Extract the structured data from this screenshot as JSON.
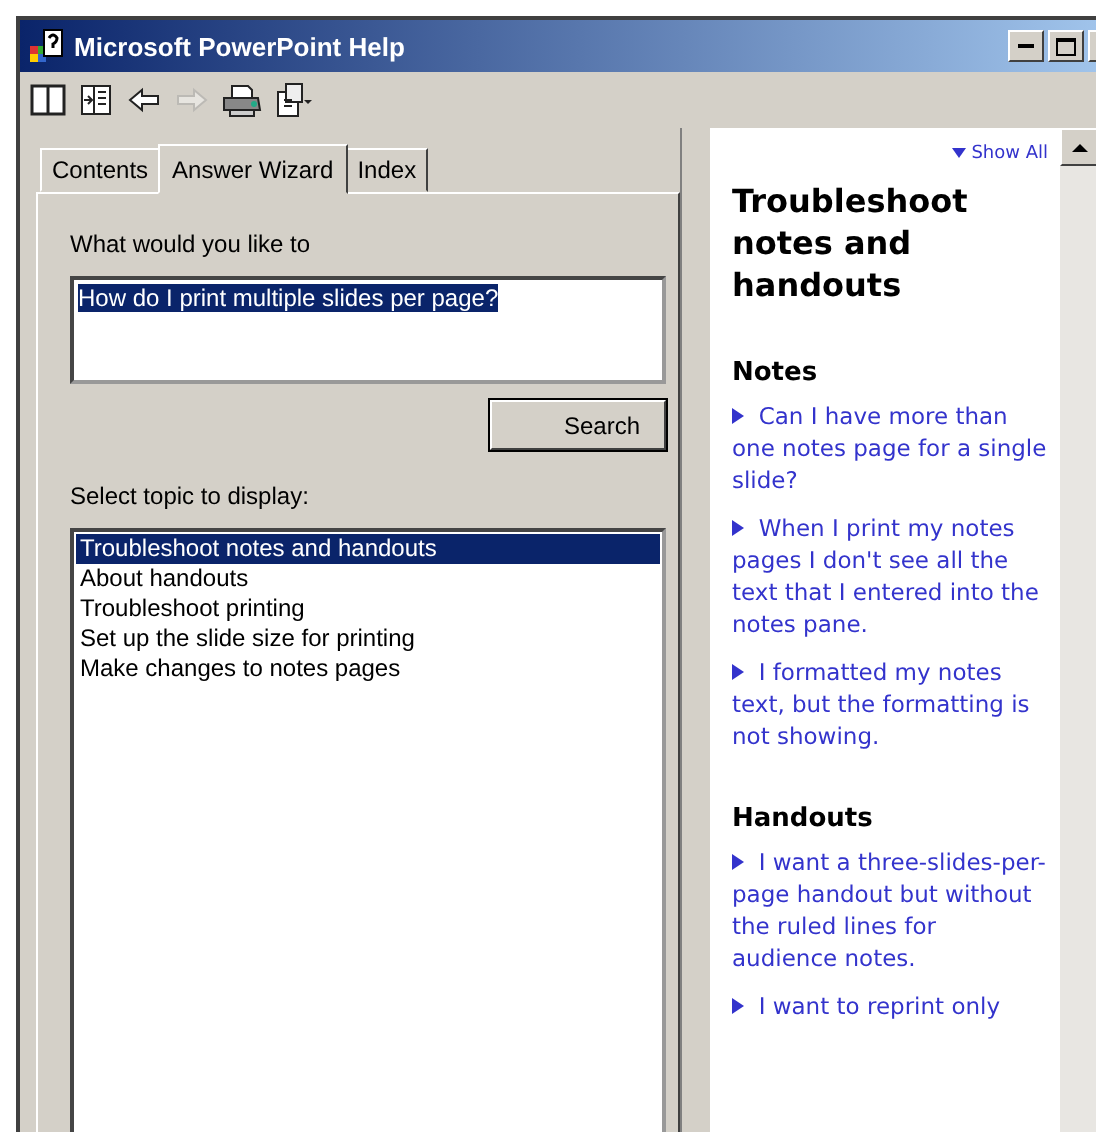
{
  "window": {
    "title": "Microsoft PowerPoint Help"
  },
  "toolbar": [
    {
      "kind": "split",
      "disabled": false
    },
    {
      "kind": "contents",
      "disabled": false
    },
    {
      "kind": "back",
      "disabled": false
    },
    {
      "kind": "forward",
      "disabled": true
    },
    {
      "kind": "print",
      "disabled": false
    },
    {
      "kind": "options",
      "disabled": false
    }
  ],
  "tabs": [
    {
      "label": "Contents",
      "selected": false
    },
    {
      "label": "Answer Wizard",
      "selected": true
    },
    {
      "label": "Index",
      "selected": false
    }
  ],
  "question": {
    "label": "What would you like to",
    "value": "How do I print multiple slides per page?"
  },
  "search_button": "Search",
  "topics": {
    "label": "Select topic to display:",
    "items": [
      {
        "label": "Troubleshoot notes and handouts",
        "selected": true
      },
      {
        "label": "About handouts",
        "selected": false
      },
      {
        "label": "Troubleshoot printing",
        "selected": false
      },
      {
        "label": "Set up the slide size for printing",
        "selected": false
      },
      {
        "label": "Make changes to notes pages",
        "selected": false
      }
    ]
  },
  "article": {
    "show_all": "Show All",
    "title": "Troubleshoot notes and handouts",
    "sections": [
      {
        "heading": "Notes",
        "links": [
          "Can I have more than one notes page for a single slide?",
          "When I print my notes pages I don't see all the text that I entered into the notes pane.",
          "I formatted my notes text, but the formatting is not showing."
        ]
      },
      {
        "heading": "Handouts",
        "links": [
          "I want a three-slides-per-page handout but without the ruled lines for audience notes.",
          "I want to reprint only"
        ]
      }
    ]
  }
}
